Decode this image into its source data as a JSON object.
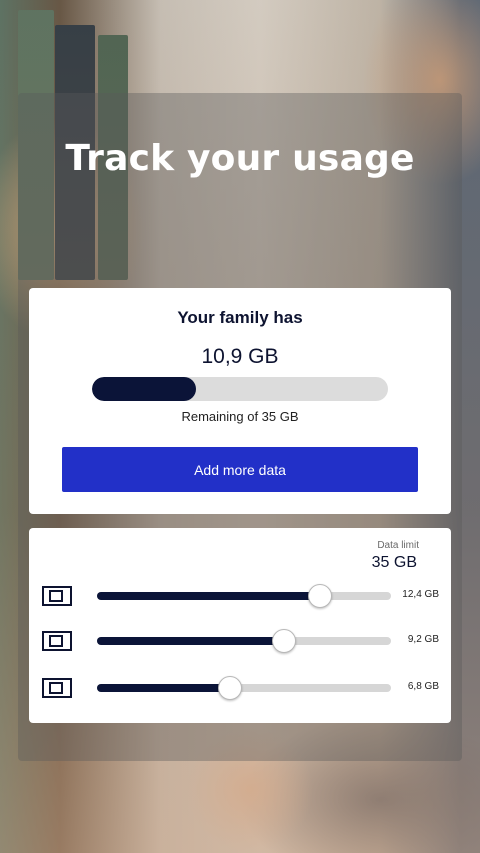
{
  "title": "Track your usage",
  "family": {
    "heading": "Your family has",
    "amount": "10,9 GB",
    "remaining_text": "Remaining of 35 GB",
    "usage_fraction": 0.35,
    "add_button_label": "Add more data"
  },
  "limits": {
    "label": "Data limit",
    "total": "35 GB",
    "sims": [
      {
        "value": "12,4 GB",
        "fraction": 0.754
      },
      {
        "value": "9,2 GB",
        "fraction": 0.634
      },
      {
        "value": "6,8 GB",
        "fraction": 0.45
      }
    ]
  },
  "colors": {
    "accent": "#2230c8",
    "bar_fill": "#0b1438",
    "track": "#d6d6d6"
  },
  "icons": {
    "sim": "sim-card-icon"
  }
}
